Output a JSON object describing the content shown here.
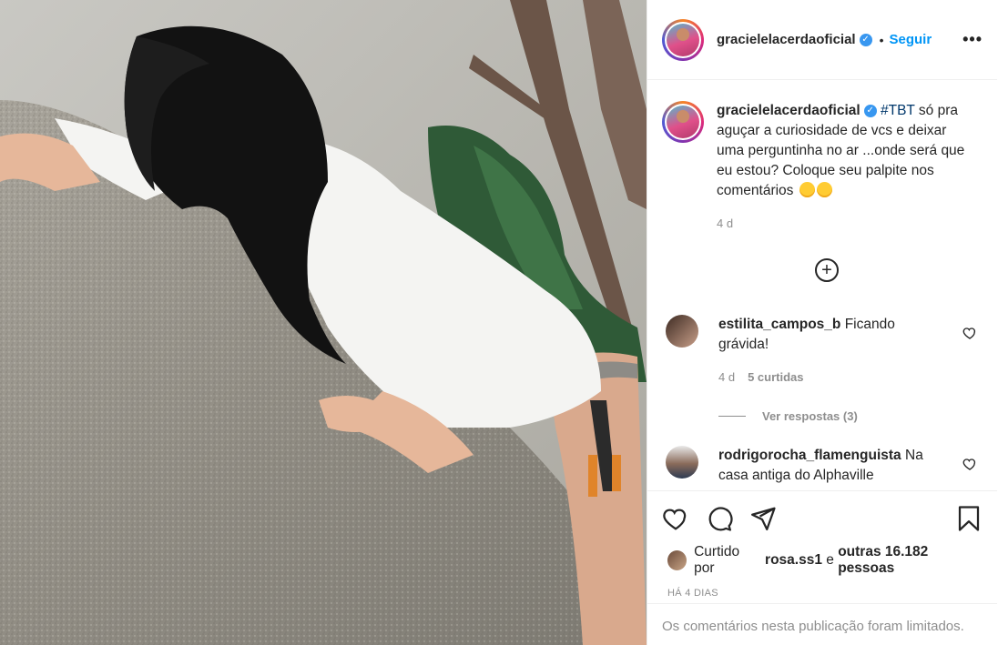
{
  "header": {
    "username": "gracielelacerdaoficial",
    "dot": "•",
    "follow_label": "Seguir",
    "more_label": "•••"
  },
  "caption": {
    "username": "gracielelacerdaoficial",
    "hashtag": "#TBT",
    "text": " só pra aguçar a curiosidade de vcs e deixar uma perguntinha no ar ...onde será que eu estou? Coloque seu palpite nos comentários ",
    "age": "4 d"
  },
  "load_more_label": "+",
  "comments": [
    {
      "username": "estilita_campos_b",
      "text": " Ficando grávida!",
      "age": "4 d",
      "likes": "5 curtidas"
    },
    {
      "username": "rodrigorocha_flamenguista",
      "text": " Na casa antiga do Alphaville"
    }
  ],
  "replies_label": "Ver respostas (3)",
  "likes": {
    "prefix": "Curtido por ",
    "user": "rosa.ss1",
    "mid": " e ",
    "others": "outras 16.182 pessoas"
  },
  "timestamp": "HÁ 4 DIAS",
  "limited_notice": "Os comentários nesta publicação foram limitados.",
  "colors": {
    "link_blue": "#0095f6",
    "muted": "#8e8e8e",
    "text": "#262626"
  },
  "icons": [
    "heart-icon",
    "comment-icon",
    "share-icon",
    "bookmark-icon",
    "verified-icon",
    "plus-circle-icon"
  ]
}
